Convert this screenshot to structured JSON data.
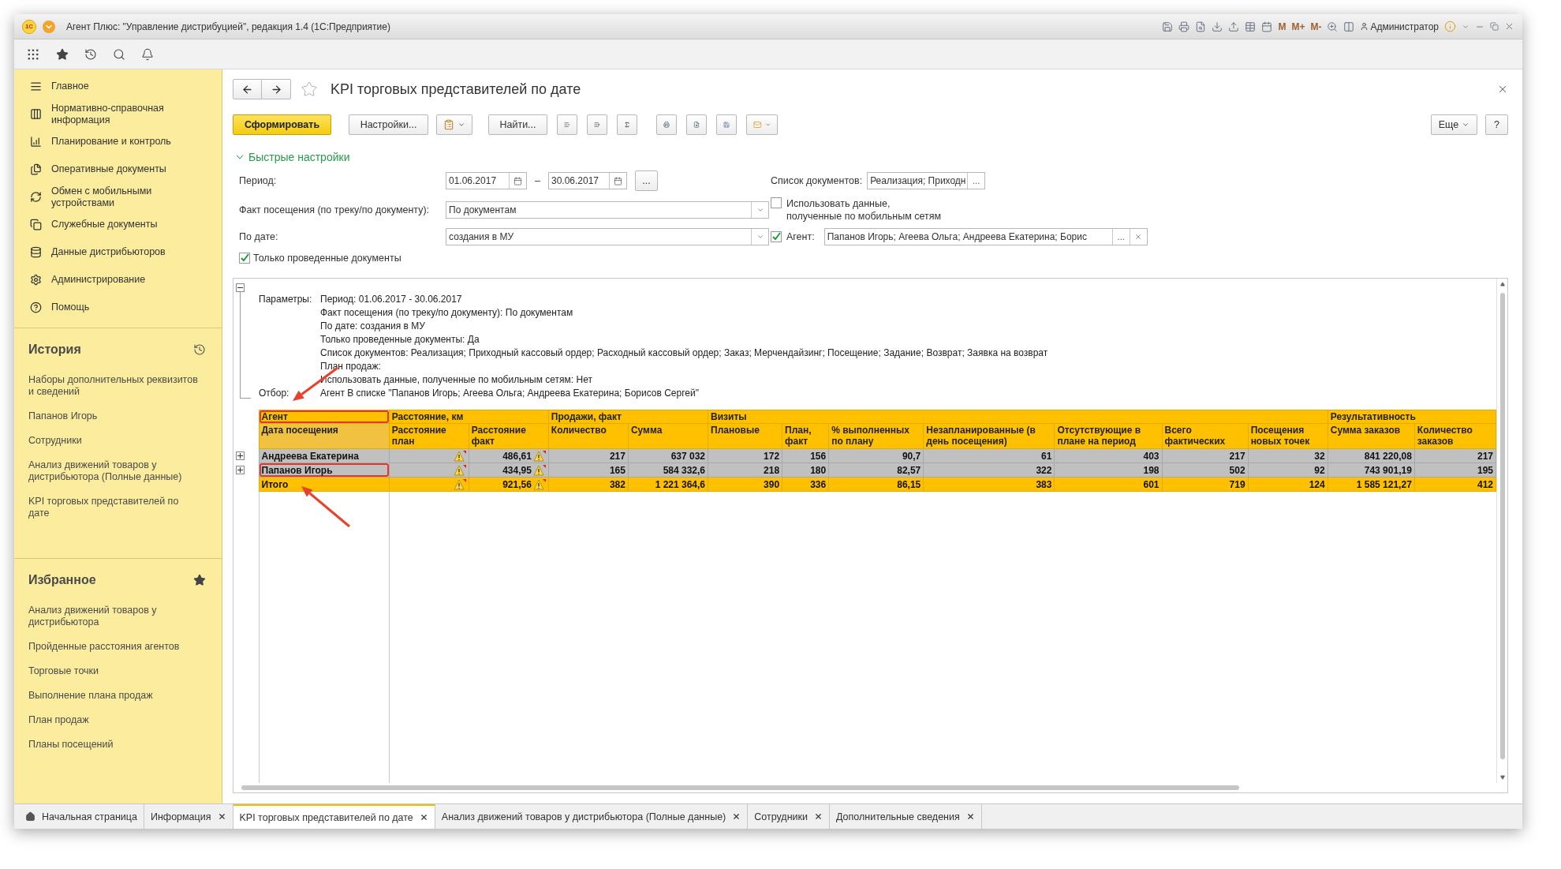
{
  "window": {
    "logo": "1С",
    "title": "Агент Плюс: \"Управление дистрибуцией\", редакция 1.4  (1С:Предприятие)",
    "memory_buttons": [
      "M",
      "M+",
      "M-"
    ],
    "user": "Администратор"
  },
  "sidebar": {
    "sections": [
      {
        "label": "Главное"
      },
      {
        "label": "Нормативно-справочная информация"
      },
      {
        "label": "Планирование и контроль"
      },
      {
        "label": "Оперативные документы"
      },
      {
        "label": "Обмен с мобильными устройствами"
      },
      {
        "label": "Служебные документы"
      },
      {
        "label": "Данные дистрибьюторов"
      },
      {
        "label": "Администрирование"
      },
      {
        "label": "Помощь"
      }
    ],
    "history": {
      "title": "История",
      "items": [
        "Наборы дополнительных реквизитов и сведений",
        "Папанов Игорь",
        "Сотрудники",
        "Анализ движений товаров у дистрибьютора (Полные данные)",
        "KPI торговых представителей по дате"
      ]
    },
    "favorites": {
      "title": "Избранное",
      "items": [
        "Анализ движений товаров у дистрибьютора",
        "Пройденные расстояния агентов",
        "Торговые точки",
        "Выполнение плана продаж",
        "План продаж",
        "Планы посещений"
      ]
    }
  },
  "form": {
    "title": "KPI торговых представителей по дате",
    "favorite": false,
    "buttons": {
      "generate": "Сформировать",
      "settings": "Настройки...",
      "find": "Найти...",
      "more": "Еще",
      "help": "?"
    },
    "quick_settings": {
      "title": "Быстрые настройки",
      "expanded": true,
      "period": {
        "label": "Период:",
        "from": "01.06.2017",
        "separator": "–",
        "to": "30.06.2017",
        "more": "..."
      },
      "documents": {
        "label": "Список документов:",
        "value": "Реализация; Приходн",
        "more": "..."
      },
      "visit_fact": {
        "label": "Факт посещения (по треку/по документу):",
        "value": "По документам"
      },
      "mobile_data": {
        "label": "Использовать данные,\nполученные по мобильным сетям",
        "checked": false
      },
      "by_date": {
        "label": "По дате:",
        "value": "создания в МУ"
      },
      "agent": {
        "label": "Агент:",
        "checked": true,
        "value": "Папанов Игорь; Агеева Ольга; Андреева Екатерина; Борис",
        "more": "..."
      },
      "posted_only": {
        "label": "Только проведенные документы",
        "checked": true
      }
    }
  },
  "report": {
    "parameters": {
      "label": "Параметры:",
      "lines": [
        "Период: 01.06.2017 - 30.06.2017",
        "Факт посещения (по треку/по документу): По документам",
        "По дате: создания в МУ",
        "Только проведенные документы: Да",
        "Список документов: Реализация; Приходный кассовый ордер; Расходный кассовый ордер; Заказ; Мерчендайзинг; Посещение; Задание; Возврат; Заявка на возврат",
        "План продаж:",
        "Использовать данные, полученные по мобильным сетям: Нет"
      ]
    },
    "filter": {
      "label": "Отбор:",
      "text": "Агент В списке \"Папанов Игорь; Агеева Ольга; Андреева Екатерина; Борисов Сергей\""
    },
    "table": {
      "column_groups": [
        {
          "label": "Агент",
          "highlighted": true,
          "columns": [
            {
              "label": "Дата посещения",
              "kind": "name"
            }
          ]
        },
        {
          "label": "Расстояние, км",
          "highlighted": false,
          "columns": [
            {
              "label": "Расстояние план",
              "kind": "flag"
            },
            {
              "label": "Расстояние факт",
              "kind": "flagged_number"
            }
          ]
        },
        {
          "label": "Продажи, факт",
          "highlighted": false,
          "columns": [
            {
              "label": "Количество",
              "kind": "number"
            },
            {
              "label": "Сумма",
              "kind": "number"
            }
          ]
        },
        {
          "label": "Визиты",
          "highlighted": false,
          "columns": [
            {
              "label": "Плановые",
              "kind": "number"
            },
            {
              "label": "План, факт",
              "kind": "number"
            },
            {
              "label": "% выполненных по плану",
              "kind": "number"
            },
            {
              "label": "Незапланированные (в день посещения)",
              "kind": "number"
            },
            {
              "label": "Отсутствующие в плане на период",
              "kind": "number"
            },
            {
              "label": "Всего фактических",
              "kind": "number"
            },
            {
              "label": "Посещения новых точек",
              "kind": "number"
            }
          ]
        },
        {
          "label": "Результативность",
          "highlighted": false,
          "columns": [
            {
              "label": "Сумма заказов",
              "kind": "number"
            },
            {
              "label": "Количество заказов",
              "kind": "number"
            }
          ]
        }
      ],
      "rows": [
        {
          "kind": "agent",
          "highlighted": false,
          "values": [
            "Андреева Екатерина",
            "486,61",
            "217",
            "637 032",
            "172",
            "156",
            "90,7",
            "61",
            "403",
            "217",
            "32",
            "841 220,08",
            "217"
          ]
        },
        {
          "kind": "agent",
          "highlighted": true,
          "values": [
            "Папанов Игорь",
            "434,95",
            "165",
            "584 332,6",
            "218",
            "180",
            "82,57",
            "322",
            "198",
            "502",
            "92",
            "743 901,19",
            "195"
          ]
        },
        {
          "kind": "total",
          "highlighted": false,
          "values": [
            "Итого",
            "921,56",
            "382",
            "1 221 364,6",
            "390",
            "336",
            "86,15",
            "383",
            "601",
            "719",
            "124",
            "1 585 121,27",
            "412"
          ]
        }
      ]
    }
  },
  "tabs": [
    {
      "label": "Начальная страница",
      "kind": "home",
      "closable": false,
      "selected": false
    },
    {
      "label": "Информация",
      "kind": "page",
      "closable": true,
      "selected": false
    },
    {
      "label": "KPI торговых представителей по дате",
      "kind": "page",
      "closable": true,
      "selected": true
    },
    {
      "label": "Анализ движений товаров у дистрибьютора (Полные данные)",
      "kind": "page",
      "closable": true,
      "selected": false
    },
    {
      "label": "Сотрудники",
      "kind": "page",
      "closable": true,
      "selected": false
    },
    {
      "label": "Дополнительные сведения",
      "kind": "page",
      "closable": true,
      "selected": false
    }
  ]
}
